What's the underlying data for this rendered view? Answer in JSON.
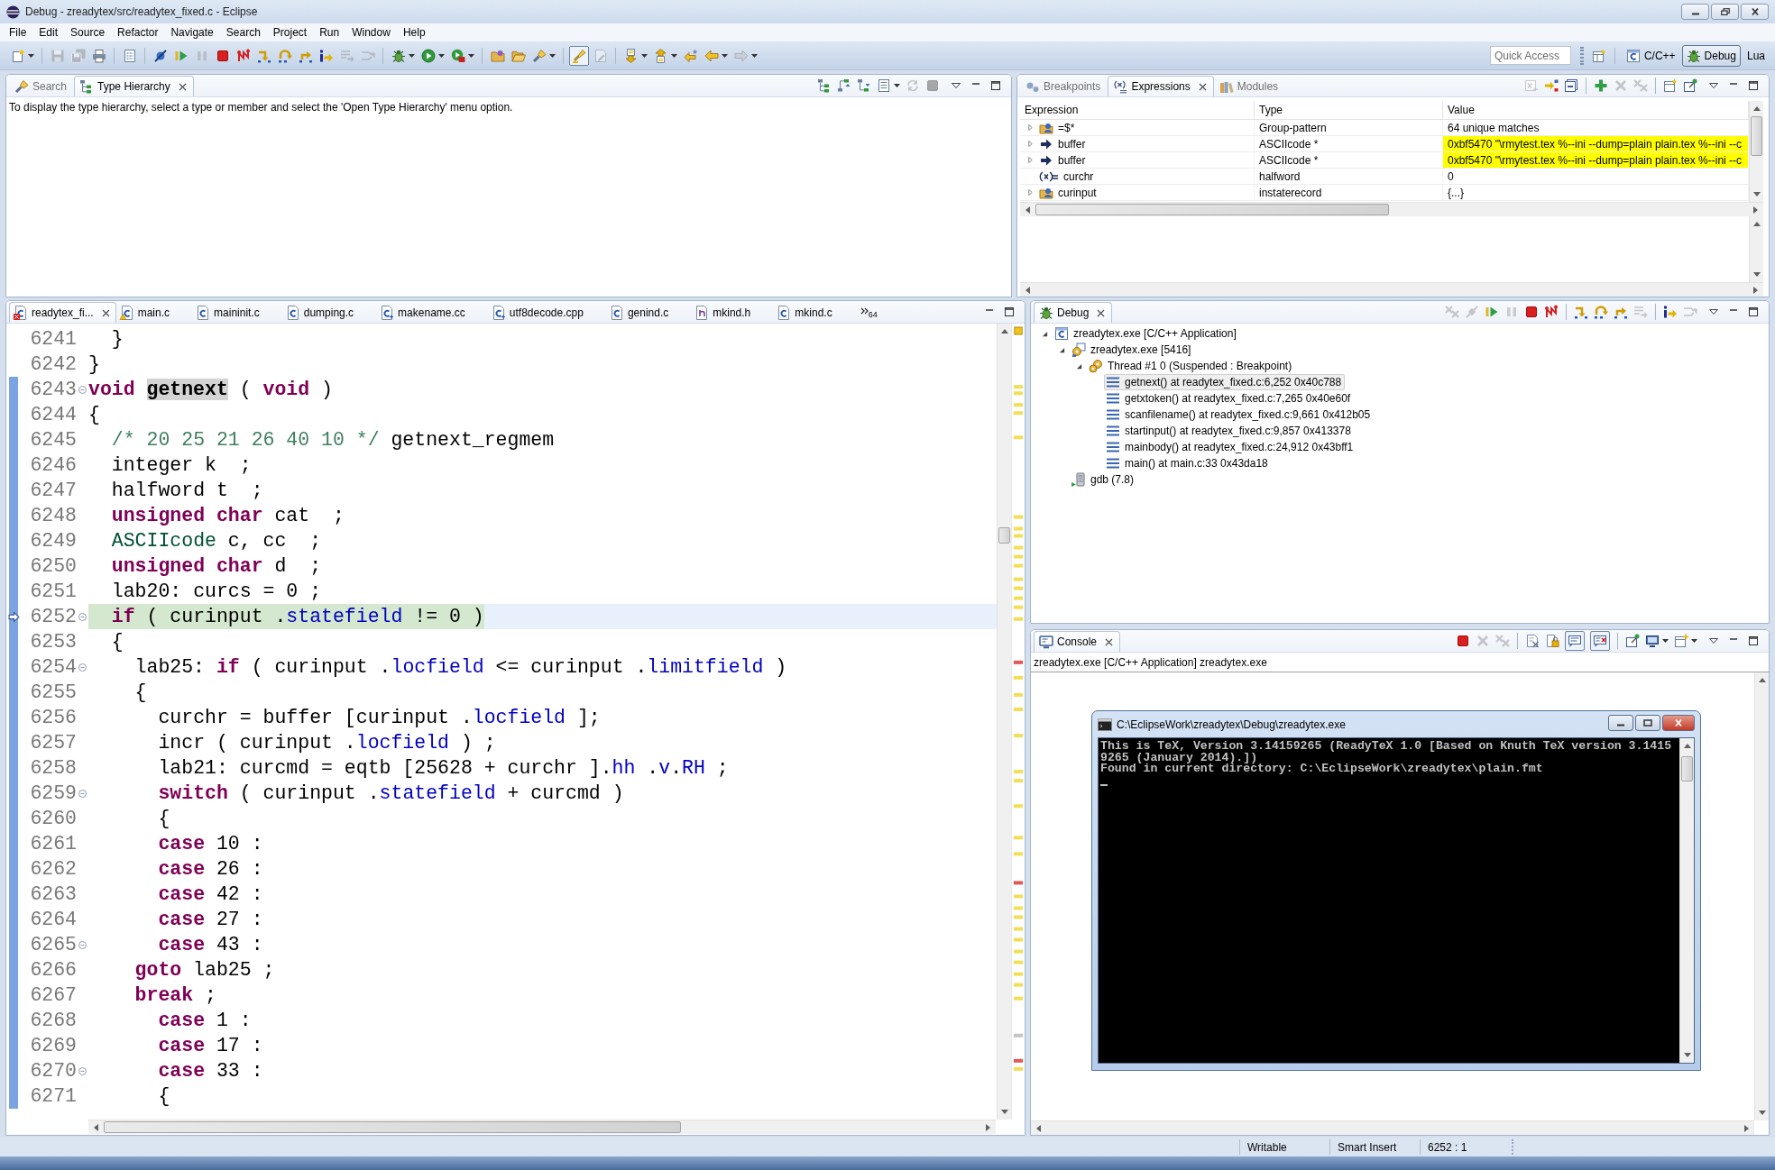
{
  "window": {
    "title": "Debug - zreadytex/src/readytex_fixed.c - Eclipse"
  },
  "menu": [
    "File",
    "Edit",
    "Source",
    "Refactor",
    "Navigate",
    "Search",
    "Project",
    "Run",
    "Window",
    "Help"
  ],
  "toolbar": {
    "groups": [
      [
        {
          "kind": "new",
          "dropdown": true,
          "disabled": false,
          "pressed": false
        }
      ],
      [
        {
          "kind": "save",
          "dropdown": false,
          "disabled": true,
          "pressed": false
        },
        {
          "kind": "save_all",
          "dropdown": false,
          "disabled": true,
          "pressed": false
        },
        {
          "kind": "print",
          "dropdown": false,
          "disabled": false,
          "pressed": false
        }
      ],
      [
        {
          "kind": "binary",
          "dropdown": false,
          "disabled": false,
          "pressed": false
        }
      ],
      [
        {
          "kind": "skip_breakpoints",
          "dropdown": false,
          "disabled": false,
          "pressed": false
        },
        {
          "kind": "resume",
          "dropdown": false,
          "disabled": false,
          "pressed": false
        },
        {
          "kind": "suspend",
          "dropdown": false,
          "disabled": true,
          "pressed": false
        },
        {
          "kind": "terminate",
          "dropdown": false,
          "disabled": false,
          "pressed": false
        },
        {
          "kind": "disconnect",
          "dropdown": false,
          "disabled": false,
          "pressed": false
        },
        {
          "kind": "step_into",
          "dropdown": false,
          "disabled": false,
          "pressed": false
        },
        {
          "kind": "step_over",
          "dropdown": false,
          "disabled": false,
          "pressed": false
        },
        {
          "kind": "step_return",
          "dropdown": false,
          "disabled": false,
          "pressed": false
        },
        {
          "kind": "instruction_stepping",
          "dropdown": false,
          "disabled": false,
          "pressed": false
        },
        {
          "kind": "drop_to_frame",
          "dropdown": false,
          "disabled": true,
          "pressed": false
        },
        {
          "kind": "step_filters",
          "dropdown": false,
          "disabled": true,
          "pressed": false
        }
      ],
      [
        {
          "kind": "debug",
          "dropdown": true,
          "disabled": false,
          "pressed": false
        },
        {
          "kind": "run",
          "dropdown": true,
          "disabled": false,
          "pressed": false
        },
        {
          "kind": "external_tools",
          "dropdown": true,
          "disabled": false,
          "pressed": false
        }
      ],
      [
        {
          "kind": "open_type",
          "dropdown": false,
          "disabled": false,
          "pressed": false
        },
        {
          "kind": "open_folder",
          "dropdown": false,
          "disabled": false,
          "pressed": false
        },
        {
          "kind": "search",
          "dropdown": true,
          "disabled": false,
          "pressed": false
        }
      ],
      [
        {
          "kind": "mark_occurrences",
          "dropdown": false,
          "disabled": false,
          "pressed": true
        },
        {
          "kind": "toggle_edit",
          "dropdown": false,
          "disabled": true,
          "pressed": false
        }
      ],
      [
        {
          "kind": "next_annotation",
          "dropdown": true,
          "disabled": false,
          "pressed": false
        },
        {
          "kind": "previous_annotation",
          "dropdown": true,
          "disabled": false,
          "pressed": false
        },
        {
          "kind": "last_edit",
          "dropdown": false,
          "disabled": false,
          "pressed": false
        },
        {
          "kind": "back",
          "dropdown": true,
          "disabled": false,
          "pressed": false
        },
        {
          "kind": "forward",
          "dropdown": true,
          "disabled": true,
          "pressed": false
        }
      ]
    ],
    "quick_access": {
      "placeholder": "Quick Access"
    },
    "perspectives": [
      {
        "kind": "c",
        "label": "C/C++",
        "selected": false
      },
      {
        "kind": "debug",
        "label": "Debug",
        "selected": true
      },
      {
        "kind": "lua",
        "label": "Lua",
        "selected": false
      }
    ]
  },
  "type_hierarchy": {
    "tabs": [
      {
        "kind": "search",
        "label": "Search",
        "selected": false
      },
      {
        "kind": "hierarchy",
        "label": "Type Hierarchy",
        "selected": true
      }
    ],
    "toolbar": [
      [
        {
          "kind": "hierarchy_view",
          "dropdown": false,
          "disabled": false,
          "pressed": false
        },
        {
          "kind": "supertypes",
          "dropdown": false,
          "disabled": false,
          "pressed": false
        },
        {
          "kind": "subtypes",
          "dropdown": false,
          "disabled": false,
          "pressed": false
        },
        {
          "kind": "layout",
          "dropdown": true,
          "disabled": false,
          "pressed": false
        },
        {
          "kind": "sync",
          "dropdown": false,
          "disabled": true,
          "pressed": false
        },
        {
          "kind": "terminate",
          "dropdown": false,
          "disabled": true,
          "pressed": false
        }
      ]
    ],
    "message": "To display the type hierarchy, select a type or member and select the 'Open Type Hierarchy' menu option."
  },
  "expressions": {
    "tabs": [
      {
        "kind": "breakpoints",
        "label": "Breakpoints",
        "selected": false
      },
      {
        "kind": "expressions",
        "label": "Expressions",
        "selected": true
      },
      {
        "kind": "modules",
        "label": "Modules",
        "selected": false
      }
    ],
    "toolbar": [
      [
        {
          "kind": "type_names",
          "dropdown": false,
          "disabled": true,
          "pressed": false
        },
        {
          "kind": "logical_structure",
          "dropdown": false,
          "disabled": false,
          "pressed": false
        },
        {
          "kind": "collapse_all",
          "dropdown": false,
          "disabled": false,
          "pressed": false
        }
      ],
      [
        {
          "kind": "add",
          "dropdown": false,
          "disabled": false,
          "pressed": false
        },
        {
          "kind": "remove",
          "dropdown": false,
          "disabled": true,
          "pressed": false
        },
        {
          "kind": "remove_all",
          "dropdown": false,
          "disabled": true,
          "pressed": false
        }
      ],
      [
        {
          "kind": "new_view",
          "dropdown": false,
          "disabled": false,
          "pressed": false
        },
        {
          "kind": "pin",
          "dropdown": false,
          "disabled": false,
          "pressed": false
        }
      ]
    ],
    "columns": [
      "Expression",
      "Type",
      "Value"
    ],
    "rows": [
      {
        "kind": "group",
        "expandable": true,
        "expression": "=$*",
        "type": "Group-pattern",
        "value": "64 unique matches",
        "changed": false
      },
      {
        "kind": "pointer",
        "expandable": true,
        "expression": "buffer",
        "type": "ASCIIcode *",
        "value": "0xbf5470 \"\\rmytest.tex %--ini --dump=plain plain.tex %--ini --c",
        "changed": true
      },
      {
        "kind": "pointer",
        "expandable": true,
        "expression": "buffer",
        "type": "ASCIIcode *",
        "value": "0xbf5470 \"\\rmytest.tex %--ini --dump=plain plain.tex %--ini --c",
        "changed": true
      },
      {
        "kind": "variable",
        "expandable": false,
        "expression": "curchr",
        "type": "halfword",
        "value": "0",
        "changed": false
      },
      {
        "kind": "group",
        "expandable": true,
        "expression": "curinput",
        "type": "instaterecord",
        "value": "{...}",
        "changed": false
      }
    ]
  },
  "editor": {
    "tabs": [
      {
        "kind": "c_error",
        "label": "readytex_fi...",
        "selected": true
      },
      {
        "kind": "c_warning",
        "label": "main.c",
        "selected": false
      },
      {
        "kind": "c",
        "label": "maininit.c",
        "selected": false
      },
      {
        "kind": "c",
        "label": "dumping.c",
        "selected": false
      },
      {
        "kind": "cc",
        "label": "makename.cc",
        "selected": false
      },
      {
        "kind": "cpp",
        "label": "utf8decode.cpp",
        "selected": false
      },
      {
        "kind": "c",
        "label": "genind.c",
        "selected": false
      },
      {
        "kind": "h",
        "label": "mkind.h",
        "selected": false
      },
      {
        "kind": "c",
        "label": "mkind.c",
        "selected": false
      }
    ],
    "more_tabs": "64",
    "lines": [
      {
        "number": "6241",
        "fold": false,
        "in_range": false,
        "current": false,
        "segments": [
          {
            "kind": "plain",
            "text": "  }"
          }
        ]
      },
      {
        "number": "6242",
        "fold": false,
        "in_range": false,
        "current": false,
        "segments": [
          {
            "kind": "plain",
            "text": "}"
          }
        ]
      },
      {
        "number": "6243",
        "fold": true,
        "in_range": true,
        "current": false,
        "segments": [
          {
            "kind": "keyword",
            "text": "void "
          },
          {
            "kind": "match",
            "text": "getnext"
          },
          {
            "kind": "plain",
            "text": " ( "
          },
          {
            "kind": "keyword",
            "text": "void"
          },
          {
            "kind": "plain",
            "text": " )"
          }
        ]
      },
      {
        "number": "6244",
        "fold": false,
        "in_range": true,
        "current": false,
        "segments": [
          {
            "kind": "plain",
            "text": "{"
          }
        ]
      },
      {
        "number": "6245",
        "fold": false,
        "in_range": true,
        "current": false,
        "segments": [
          {
            "kind": "comment",
            "text": "  /* 20 25 21 26 40 10 */"
          },
          {
            "kind": "plain",
            "text": " getnext_regmem"
          }
        ]
      },
      {
        "number": "6246",
        "fold": false,
        "in_range": true,
        "current": false,
        "segments": [
          {
            "kind": "plain",
            "text": "  integer k  ;"
          }
        ]
      },
      {
        "number": "6247",
        "fold": false,
        "in_range": true,
        "current": false,
        "segments": [
          {
            "kind": "plain",
            "text": "  halfword t  ;"
          }
        ]
      },
      {
        "number": "6248",
        "fold": false,
        "in_range": true,
        "current": false,
        "segments": [
          {
            "kind": "keyword",
            "text": "  unsigned char"
          },
          {
            "kind": "plain",
            "text": " cat  ;"
          }
        ]
      },
      {
        "number": "6249",
        "fold": false,
        "in_range": true,
        "current": false,
        "segments": [
          {
            "kind": "type",
            "text": "  ASCIIcode"
          },
          {
            "kind": "plain",
            "text": " c, cc  ;"
          }
        ]
      },
      {
        "number": "6250",
        "fold": false,
        "in_range": true,
        "current": false,
        "segments": [
          {
            "kind": "keyword",
            "text": "  unsigned char"
          },
          {
            "kind": "plain",
            "text": " d  ;"
          }
        ]
      },
      {
        "number": "6251",
        "fold": false,
        "in_range": true,
        "current": false,
        "segments": [
          {
            "kind": "plain",
            "text": "  lab20: curcs = 0 ;"
          }
        ]
      },
      {
        "number": "6252",
        "fold": true,
        "in_range": true,
        "current": true,
        "segments": [
          {
            "kind": "keyword",
            "text": "  if"
          },
          {
            "kind": "plain",
            "text": " ( curinput ."
          },
          {
            "kind": "field",
            "text": "statefield"
          },
          {
            "kind": "plain",
            "text": " != 0 )"
          }
        ]
      },
      {
        "number": "6253",
        "fold": false,
        "in_range": true,
        "current": false,
        "segments": [
          {
            "kind": "plain",
            "text": "  {"
          }
        ]
      },
      {
        "number": "6254",
        "fold": true,
        "in_range": true,
        "current": false,
        "segments": [
          {
            "kind": "plain",
            "text": "    lab25: "
          },
          {
            "kind": "keyword",
            "text": "if"
          },
          {
            "kind": "plain",
            "text": " ( curinput ."
          },
          {
            "kind": "field",
            "text": "locfield"
          },
          {
            "kind": "plain",
            "text": " <= curinput ."
          },
          {
            "kind": "field",
            "text": "limitfield"
          },
          {
            "kind": "plain",
            "text": " )"
          }
        ]
      },
      {
        "number": "6255",
        "fold": false,
        "in_range": true,
        "current": false,
        "segments": [
          {
            "kind": "plain",
            "text": "    {"
          }
        ]
      },
      {
        "number": "6256",
        "fold": false,
        "in_range": true,
        "current": false,
        "segments": [
          {
            "kind": "plain",
            "text": "      curchr = buffer [curinput ."
          },
          {
            "kind": "field",
            "text": "locfield"
          },
          {
            "kind": "plain",
            "text": " ];"
          }
        ]
      },
      {
        "number": "6257",
        "fold": false,
        "in_range": true,
        "current": false,
        "segments": [
          {
            "kind": "plain",
            "text": "      incr ( curinput ."
          },
          {
            "kind": "field",
            "text": "locfield"
          },
          {
            "kind": "plain",
            "text": " ) ;"
          }
        ]
      },
      {
        "number": "6258",
        "fold": false,
        "in_range": true,
        "current": false,
        "segments": [
          {
            "kind": "plain",
            "text": "      lab21: curcmd = eqtb [25628 + curchr ]."
          },
          {
            "kind": "field",
            "text": "hh"
          },
          {
            "kind": "plain",
            "text": " ."
          },
          {
            "kind": "field",
            "text": "v"
          },
          {
            "kind": "plain",
            "text": "."
          },
          {
            "kind": "field",
            "text": "RH"
          },
          {
            "kind": "plain",
            "text": " ;"
          }
        ]
      },
      {
        "number": "6259",
        "fold": true,
        "in_range": true,
        "current": false,
        "segments": [
          {
            "kind": "keyword",
            "text": "      switch"
          },
          {
            "kind": "plain",
            "text": " ( curinput ."
          },
          {
            "kind": "field",
            "text": "statefield"
          },
          {
            "kind": "plain",
            "text": " + curcmd )"
          }
        ]
      },
      {
        "number": "6260",
        "fold": false,
        "in_range": true,
        "current": false,
        "segments": [
          {
            "kind": "plain",
            "text": "      {"
          }
        ]
      },
      {
        "number": "6261",
        "fold": false,
        "in_range": true,
        "current": false,
        "segments": [
          {
            "kind": "keyword",
            "text": "      case"
          },
          {
            "kind": "plain",
            "text": " 10 :"
          }
        ]
      },
      {
        "number": "6262",
        "fold": false,
        "in_range": true,
        "current": false,
        "segments": [
          {
            "kind": "keyword",
            "text": "      case"
          },
          {
            "kind": "plain",
            "text": " 26 :"
          }
        ]
      },
      {
        "number": "6263",
        "fold": false,
        "in_range": true,
        "current": false,
        "segments": [
          {
            "kind": "keyword",
            "text": "      case"
          },
          {
            "kind": "plain",
            "text": " 42 :"
          }
        ]
      },
      {
        "number": "6264",
        "fold": false,
        "in_range": true,
        "current": false,
        "segments": [
          {
            "kind": "keyword",
            "text": "      case"
          },
          {
            "kind": "plain",
            "text": " 27 :"
          }
        ]
      },
      {
        "number": "6265",
        "fold": true,
        "in_range": true,
        "current": false,
        "segments": [
          {
            "kind": "keyword",
            "text": "      case"
          },
          {
            "kind": "plain",
            "text": " 43 :"
          }
        ]
      },
      {
        "number": "6266",
        "fold": false,
        "in_range": true,
        "current": false,
        "segments": [
          {
            "kind": "keyword",
            "text": "    goto"
          },
          {
            "kind": "plain",
            "text": " lab25 ;"
          }
        ]
      },
      {
        "number": "6267",
        "fold": false,
        "in_range": true,
        "current": false,
        "segments": [
          {
            "kind": "keyword",
            "text": "    break"
          },
          {
            "kind": "plain",
            "text": " ;"
          }
        ]
      },
      {
        "number": "6268",
        "fold": false,
        "in_range": true,
        "current": false,
        "segments": [
          {
            "kind": "keyword",
            "text": "      case"
          },
          {
            "kind": "plain",
            "text": " 1 :"
          }
        ]
      },
      {
        "number": "6269",
        "fold": false,
        "in_range": true,
        "current": false,
        "segments": [
          {
            "kind": "keyword",
            "text": "      case"
          },
          {
            "kind": "plain",
            "text": " 17 :"
          }
        ]
      },
      {
        "number": "6270",
        "fold": true,
        "in_range": true,
        "current": false,
        "segments": [
          {
            "kind": "keyword",
            "text": "      case"
          },
          {
            "kind": "plain",
            "text": " 33 :"
          }
        ]
      },
      {
        "number": "6271",
        "fold": false,
        "in_range": true,
        "current": false,
        "segments": [
          {
            "kind": "plain",
            "text": "      {"
          }
        ]
      }
    ]
  },
  "debug": {
    "tabs": [
      {
        "kind": "debug",
        "label": "Debug",
        "selected": true
      }
    ],
    "toolbar": [
      [
        {
          "kind": "remove_all",
          "dropdown": false,
          "disabled": true,
          "pressed": false
        },
        {
          "kind": "connect",
          "dropdown": false,
          "disabled": true,
          "pressed": false
        },
        {
          "kind": "resume",
          "dropdown": false,
          "disabled": false,
          "pressed": false
        },
        {
          "kind": "suspend",
          "dropdown": false,
          "disabled": true,
          "pressed": false
        },
        {
          "kind": "terminate",
          "dropdown": false,
          "disabled": false,
          "pressed": false
        },
        {
          "kind": "disconnect",
          "dropdown": false,
          "disabled": false,
          "pressed": false
        }
      ],
      [
        {
          "kind": "step_into",
          "dropdown": false,
          "disabled": false,
          "pressed": false
        },
        {
          "kind": "step_over",
          "dropdown": false,
          "disabled": false,
          "pressed": false
        },
        {
          "kind": "step_return",
          "dropdown": false,
          "disabled": false,
          "pressed": false
        },
        {
          "kind": "drop_to_frame",
          "dropdown": false,
          "disabled": true,
          "pressed": false
        }
      ],
      [
        {
          "kind": "instruction_stepping",
          "dropdown": false,
          "disabled": false,
          "pressed": false
        },
        {
          "kind": "step_filters",
          "dropdown": false,
          "disabled": true,
          "pressed": false
        }
      ]
    ],
    "tree": [
      {
        "kind": "launch",
        "label": "zreadytex.exe [C/C++ Application]",
        "expanded": true,
        "selected": false,
        "children": [
          {
            "kind": "process",
            "label": "zreadytex.exe [5416]",
            "expanded": true,
            "selected": false,
            "children": [
              {
                "kind": "thread",
                "label": "Thread #1 0 (Suspended : Breakpoint)",
                "expanded": true,
                "selected": false,
                "children": [
                  {
                    "kind": "frame",
                    "label": "getnext() at readytex_fixed.c:6,252 0x40c788",
                    "selected": true
                  },
                  {
                    "kind": "frame",
                    "label": "getxtoken() at readytex_fixed.c:7,265 0x40e60f",
                    "selected": false
                  },
                  {
                    "kind": "frame",
                    "label": "scanfilename() at readytex_fixed.c:9,661 0x412b05",
                    "selected": false
                  },
                  {
                    "kind": "frame",
                    "label": "startinput() at readytex_fixed.c:9,857 0x413378",
                    "selected": false
                  },
                  {
                    "kind": "frame",
                    "label": "mainbody() at readytex_fixed.c:24,912 0x43bff1",
                    "selected": false
                  },
                  {
                    "kind": "frame",
                    "label": "main() at main.c:33 0x43da18",
                    "selected": false
                  }
                ]
              }
            ]
          },
          {
            "kind": "debugger",
            "label": "gdb (7.8)",
            "selected": false
          }
        ]
      }
    ]
  },
  "console": {
    "tabs": [
      {
        "kind": "console",
        "label": "Console",
        "selected": true
      }
    ],
    "toolbar": [
      [
        {
          "kind": "terminate",
          "dropdown": false,
          "disabled": false,
          "pressed": false
        },
        {
          "kind": "remove",
          "dropdown": false,
          "disabled": true,
          "pressed": false
        },
        {
          "kind": "remove_all",
          "dropdown": false,
          "disabled": true,
          "pressed": false
        }
      ],
      [
        {
          "kind": "clear",
          "dropdown": false,
          "disabled": false,
          "pressed": false
        },
        {
          "kind": "scroll_lock",
          "dropdown": false,
          "disabled": false,
          "pressed": false
        },
        {
          "kind": "show_stdout",
          "dropdown": false,
          "disabled": false,
          "pressed": true
        },
        {
          "kind": "show_stderr",
          "dropdown": false,
          "disabled": false,
          "pressed": true
        }
      ],
      [
        {
          "kind": "pin",
          "dropdown": false,
          "disabled": false,
          "pressed": false
        },
        {
          "kind": "display_console",
          "dropdown": true,
          "disabled": false,
          "pressed": false
        },
        {
          "kind": "open_console",
          "dropdown": true,
          "disabled": false,
          "pressed": false
        }
      ]
    ],
    "description": "zreadytex.exe [C/C++ Application] zreadytex.exe",
    "terminal": {
      "title": "C:\\EclipseWork\\zreadytex\\Debug\\zreadytex.exe",
      "lines": [
        "This is TeX, Version 3.14159265 (ReadyTeX 1.0 [Based on Knuth TeX version 3.1415",
        "9265 (January 2014).])",
        "Found in current directory: C:\\EclipseWork\\zreadytex\\plain.fmt"
      ]
    }
  },
  "status_bar": [
    "Writable",
    "Smart Insert",
    "6252 : 1"
  ]
}
